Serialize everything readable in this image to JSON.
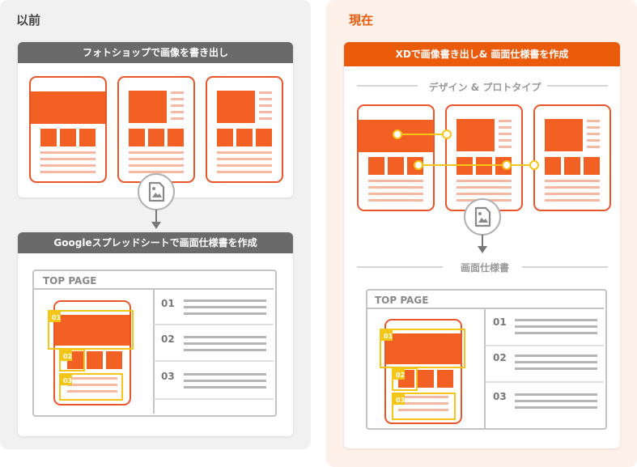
{
  "left": {
    "title": "以前",
    "step1_header": "フォトショップで画像を書き出し",
    "step2_header": "Googleスプレッドシートで画面仕様書を作成",
    "spec": {
      "page_label": "TOP PAGE",
      "rows": [
        "01",
        "02",
        "03"
      ],
      "markers": [
        "01",
        "02",
        "03"
      ]
    }
  },
  "right": {
    "title": "現在",
    "header": "XDで画像書き出し& 画面仕様書を作成",
    "design_label": "デザイン & プロトタイプ",
    "spec_label": "画面仕様書",
    "spec": {
      "page_label": "TOP PAGE",
      "rows": [
        "01",
        "02",
        "03"
      ],
      "markers": [
        "01",
        "02",
        "03"
      ]
    }
  },
  "colors": {
    "accent": "#ea5b0c",
    "block": "#f26023",
    "frame": "#e8562a",
    "stripe": "#f6b8a0",
    "dark_header": "#6a6a6a",
    "marker": "#f5c518",
    "line_gray": "#b5b5b5",
    "icon_gray": "#8a8a8a"
  }
}
